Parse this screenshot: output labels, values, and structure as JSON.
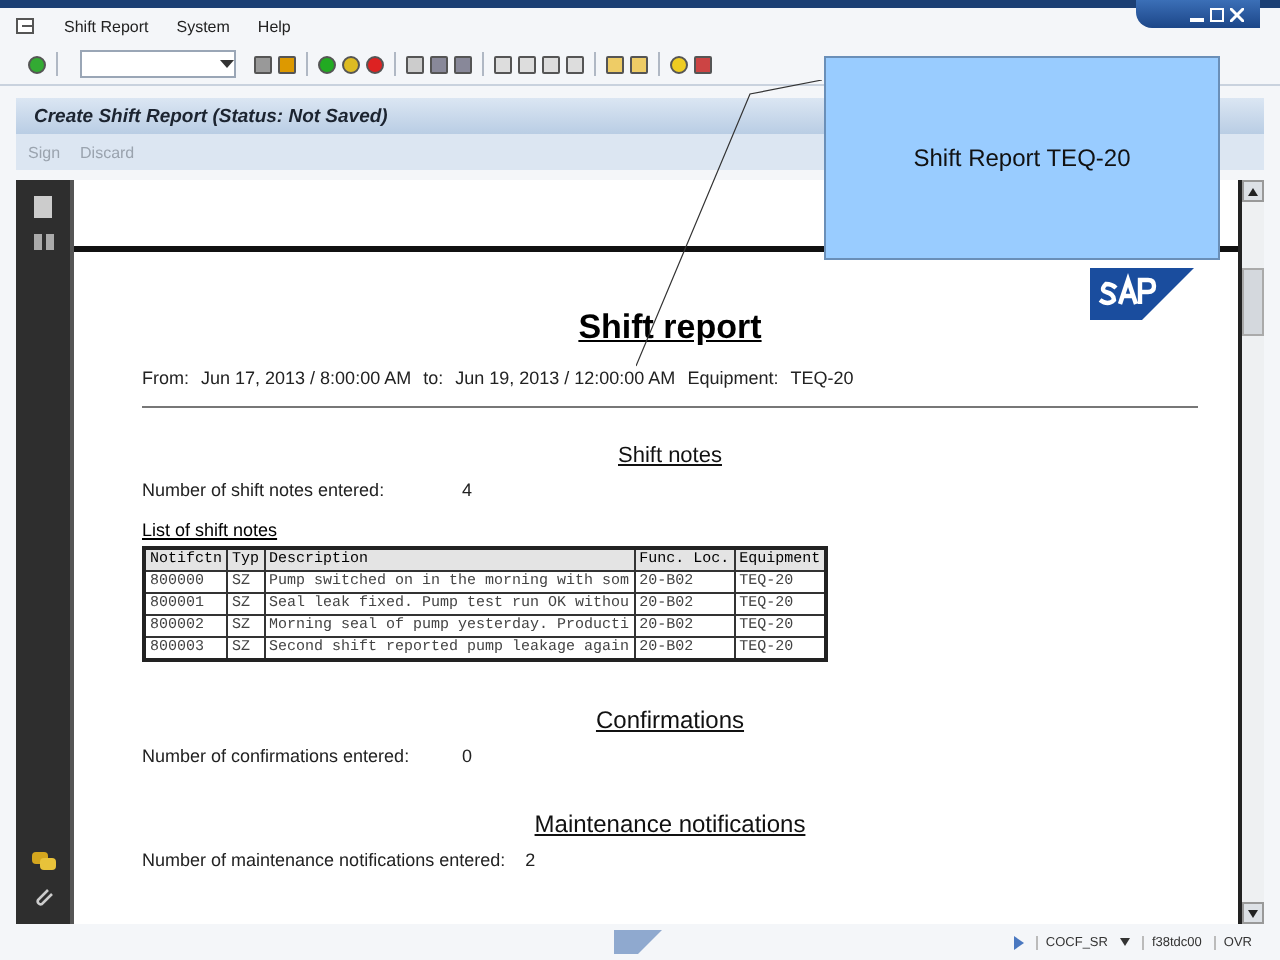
{
  "menu": [
    "Shift Report",
    "System",
    "Help"
  ],
  "title": "Create Shift Report (Status: Not Saved)",
  "app_toolbar": [
    {
      "label": "Sign",
      "disabled": true
    },
    {
      "label": "Discard",
      "disabled": true
    }
  ],
  "report": {
    "title": "Shift report",
    "from_label": "From:",
    "from": "Jun 17, 2013 / 8:00:00 AM",
    "to_label": "to:",
    "to": "Jun 19, 2013 / 12:00:00 AM",
    "equipment_label": "Equipment:",
    "equipment": "TEQ-20",
    "sections": [
      {
        "heading": "Shift notes",
        "count_label": "Number of shift notes entered:",
        "count": "4",
        "list_title": "List of shift notes",
        "table": {
          "columns": [
            "Notifctn",
            "Typ",
            "Description",
            "Func. Loc.",
            "Equipment"
          ],
          "rows": [
            [
              "800000",
              "SZ",
              "Pump switched on in the morning with som",
              "20-B02",
              "TEQ-20"
            ],
            [
              "800001",
              "SZ",
              "Seal leak fixed. Pump test run OK withou",
              "20-B02",
              "TEQ-20"
            ],
            [
              "800002",
              "SZ",
              "Morning seal of pump yesterday. Producti",
              "20-B02",
              "TEQ-20"
            ],
            [
              "800003",
              "SZ",
              "Second shift reported pump leakage again",
              "20-B02",
              "TEQ-20"
            ]
          ]
        }
      },
      {
        "heading": "Confirmations",
        "count_label": "Number of confirmations entered:",
        "count": "0"
      },
      {
        "heading": "Maintenance notifications",
        "count_label": "Number of maintenance notifications entered:",
        "count": "2"
      }
    ]
  },
  "callout": "Shift Report TEQ-20",
  "status_bar": {
    "transaction": "COCF_SR",
    "server": "f38tdc00",
    "mode": "OVR"
  }
}
